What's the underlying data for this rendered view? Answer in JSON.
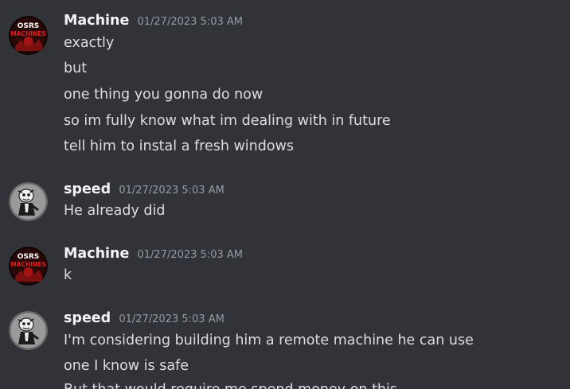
{
  "messages": [
    {
      "username": "Machine",
      "timestamp": "01/27/2023 5:03 AM",
      "avatar_icon": "osrs-machines-logo",
      "avatar_text_top": "OSRS",
      "avatar_text_bottom": "MACHINES",
      "lines": [
        "exactly",
        "but",
        "one thing you gonna do now",
        "so im fully know what im dealing with in future",
        "tell him to instal a fresh windows"
      ]
    },
    {
      "username": "speed",
      "timestamp": "01/27/2023 5:03 AM",
      "avatar_icon": "cartoon-character-avatar",
      "lines": [
        "He already did"
      ]
    },
    {
      "username": "Machine",
      "timestamp": "01/27/2023 5:03 AM",
      "avatar_icon": "osrs-machines-logo",
      "avatar_text_top": "OSRS",
      "avatar_text_bottom": "MACHINES",
      "lines": [
        "k"
      ]
    },
    {
      "username": "speed",
      "timestamp": "01/27/2023 5:03 AM",
      "avatar_icon": "cartoon-character-avatar",
      "lines": [
        "I'm considering building him a remote machine he can use",
        "one I know is safe",
        "But that would require me spend money on this"
      ]
    }
  ],
  "colors": {
    "background": "#313338",
    "username": "#f2f3f5",
    "timestamp": "#949ba4",
    "message_text": "#dbdee1",
    "machine_logo_red": "#d11a1a"
  }
}
